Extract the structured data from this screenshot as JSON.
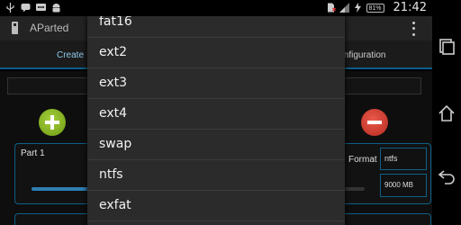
{
  "status_bar": {
    "clock": "21:42",
    "battery": "81%",
    "notification_icons": [
      "usb-icon",
      "chat-icon",
      "message-icon",
      "android-icon"
    ]
  },
  "app": {
    "title": "AParted"
  },
  "tabs": {
    "create": "Create",
    "configuration": "Configuration"
  },
  "partition": {
    "name": "Part 1",
    "format_label": "Format",
    "format_value": "ntfs",
    "size_value": "9000 MB"
  },
  "dropdown": {
    "items": [
      "fat16",
      "ext2",
      "ext3",
      "ext4",
      "swap",
      "ntfs",
      "exfat"
    ]
  },
  "colors": {
    "accent": "#2d7eb2",
    "add": "#8bbd24",
    "remove": "#d9382b"
  }
}
